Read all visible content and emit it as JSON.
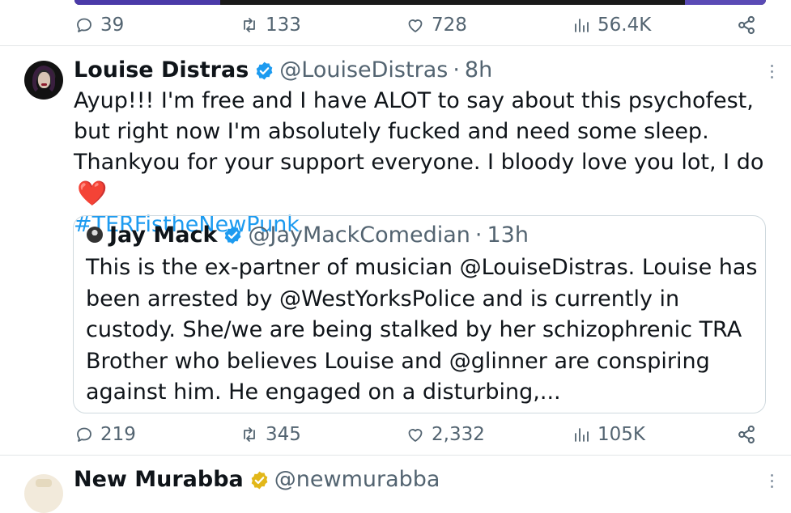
{
  "colors": {
    "text": "#0f1419",
    "muted": "#536471",
    "link": "#1d9bf0",
    "verified": "#1d9bf0",
    "verified_gold": "#e2b719",
    "heart": "#e0245e",
    "border": "#cfd9de"
  },
  "prev_tweet": {
    "actions": {
      "replies": "39",
      "retweets": "133",
      "likes": "728",
      "views": "56.4K"
    }
  },
  "tweet": {
    "author_name": "Louise Distras",
    "handle": "@LouiseDistras",
    "separator": "·",
    "time": "8h",
    "verified_icon": "verified-badge-icon",
    "text_main": "Ayup!!! I'm free and I have ALOT to say about this psychofest, but right now I'm absolutely fucked and need some sleep. Thankyou for your support everyone. I bloody love you lot, I do",
    "emoji": "❤️",
    "hashtag": "#TERFistheNewPunk",
    "quote": {
      "author_name": "Jay Mack",
      "handle": "@JayMackComedian",
      "separator": "·",
      "time": "13h",
      "text": "This is the ex-partner of musician @LouiseDistras. Louise has been arrested by @WestYorksPolice and is currently in custody. She/we are being stalked by her schizophrenic TRA Brother who believes Louise and @glinner are conspiring against him. He engaged on a disturbing,..."
    },
    "actions": {
      "replies": "219",
      "retweets": "345",
      "likes": "2,332",
      "views": "105K"
    }
  },
  "next_tweet": {
    "author_name": "New Murabba",
    "handle": "@newmurabba"
  }
}
